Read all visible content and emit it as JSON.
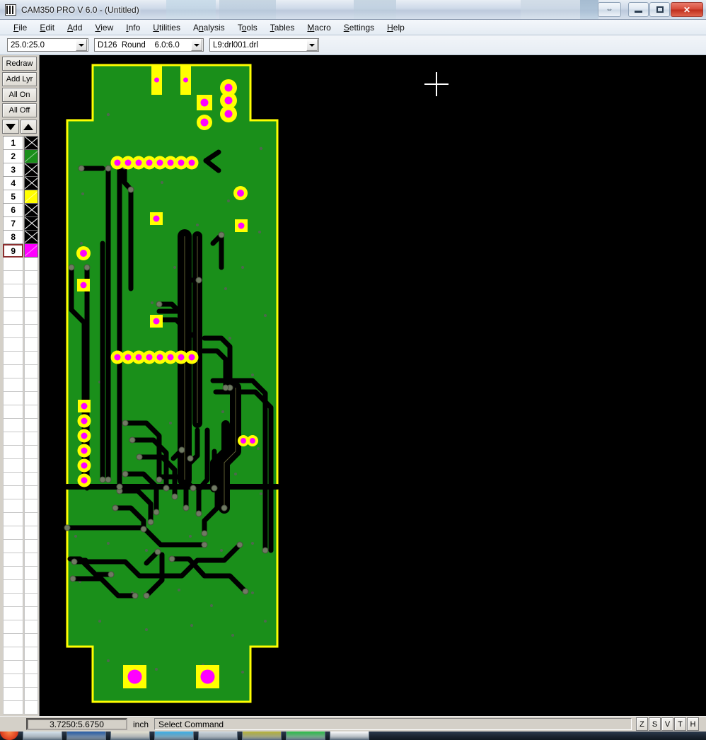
{
  "window": {
    "title": "CAM350 PRO V 6.0 - (Untitled)",
    "app_icon": "cam350-icon",
    "buttons": {
      "resize": "⇔",
      "minimize": "minimize-icon",
      "maximize": "maximize-icon",
      "close": "✕"
    }
  },
  "menubar": {
    "items": [
      {
        "label": "File",
        "accel": "F"
      },
      {
        "label": "Edit",
        "accel": "E"
      },
      {
        "label": "Add",
        "accel": "A"
      },
      {
        "label": "View",
        "accel": "V"
      },
      {
        "label": "Info",
        "accel": "I"
      },
      {
        "label": "Utilities",
        "accel": "U"
      },
      {
        "label": "Analysis",
        "accel": "n"
      },
      {
        "label": "Tools",
        "accel": "o"
      },
      {
        "label": "Tables",
        "accel": "T"
      },
      {
        "label": "Macro",
        "accel": "M"
      },
      {
        "label": "Settings",
        "accel": "S"
      },
      {
        "label": "Help",
        "accel": "H"
      }
    ]
  },
  "toolbar": {
    "grid_combo": {
      "value": "25.0:25.0",
      "name": "grid-size-dropdown"
    },
    "dcode_combo": {
      "value": "D126  Round    6.0:6.0",
      "name": "dcode-dropdown"
    },
    "layer_combo": {
      "value": "L9:drl001.drl",
      "name": "active-layer-dropdown"
    }
  },
  "sidebar": {
    "buttons": [
      {
        "label": "Redraw",
        "name": "redraw-button"
      },
      {
        "label": "Add Lyr",
        "name": "add-layer-button"
      },
      {
        "label": "All On",
        "name": "all-on-button"
      },
      {
        "label": "All Off",
        "name": "all-off-button"
      }
    ],
    "scroll": {
      "down": "▼",
      "up": "▲"
    },
    "layers": [
      {
        "num": "1",
        "color": "#000000",
        "visible": false,
        "selected": false
      },
      {
        "num": "2",
        "color": "#1a8f1a",
        "visible": true,
        "selected": false
      },
      {
        "num": "3",
        "color": "#000000",
        "visible": false,
        "selected": false
      },
      {
        "num": "4",
        "color": "#000000",
        "visible": false,
        "selected": false
      },
      {
        "num": "5",
        "color": "#ffff00",
        "visible": true,
        "selected": false
      },
      {
        "num": "6",
        "color": "#000000",
        "visible": false,
        "selected": false
      },
      {
        "num": "7",
        "color": "#000000",
        "visible": false,
        "selected": false
      },
      {
        "num": "8",
        "color": "#000000",
        "visible": false,
        "selected": false
      },
      {
        "num": "9",
        "color": "#ff00ff",
        "visible": true,
        "selected": true
      }
    ],
    "empty_rows": 34
  },
  "statusbar": {
    "coordinates": "3.7250:5.6750",
    "units": "inch",
    "command": "Select Command",
    "mini_buttons": [
      {
        "label": "Z",
        "name": "zoom-mode-button"
      },
      {
        "label": "S",
        "name": "snap-mode-button"
      },
      {
        "label": "V",
        "name": "view-mode-button"
      },
      {
        "label": "T",
        "name": "text-mode-button"
      },
      {
        "label": "H",
        "name": "help-mode-button"
      }
    ]
  },
  "taskbar": {
    "start": "start-orb",
    "items": [
      {
        "name": "taskbar-item-1",
        "color": "#d8e4ee"
      },
      {
        "name": "taskbar-item-2",
        "color": "#2a5fa8"
      },
      {
        "name": "taskbar-item-3",
        "color": "#e8e4d4"
      },
      {
        "name": "taskbar-item-4",
        "color": "#3fb2e8"
      },
      {
        "name": "taskbar-item-5",
        "color": "#cfd8e0"
      },
      {
        "name": "taskbar-item-6",
        "color": "#b9b53a"
      },
      {
        "name": "taskbar-item-7",
        "color": "#2fbf4a"
      },
      {
        "name": "taskbar-item-8",
        "color": "#ffffff"
      }
    ]
  },
  "canvas": {
    "background": "#000000",
    "cursor": "crosshair-cursor",
    "colors": {
      "board_copper": "#1a8f1a",
      "outline": "#ffff00",
      "pad": "#ffff00",
      "drill": "#ff00ff",
      "trace_void": "#000000"
    },
    "description": "PCB artwork view - drill layer L9 over copper and outline layers"
  }
}
